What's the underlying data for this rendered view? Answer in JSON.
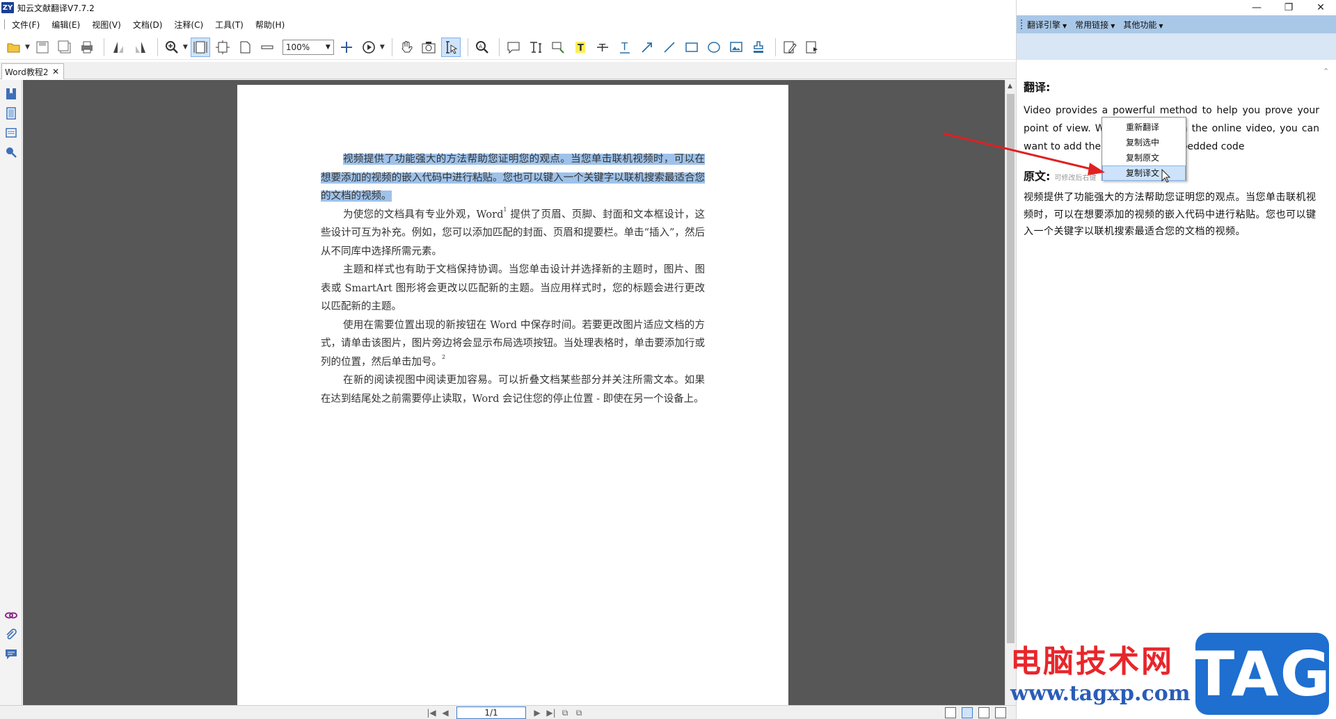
{
  "app": {
    "logo": "ZY",
    "title": "知云文献翻译V7.7.2"
  },
  "menu": [
    "文件(F)",
    "编辑(E)",
    "视图(V)",
    "文档(D)",
    "注释(C)",
    "工具(T)",
    "帮助(H)"
  ],
  "toolbar": {
    "zoom": "100%"
  },
  "tab": {
    "label": "Word教程2",
    "close": "✕"
  },
  "document": {
    "highlighted_paragraph": "视频提供了功能强大的方法帮助您证明您的观点。当您单击联机视频时，可以在想要添加的视频的嵌入代码中进行粘贴。您也可以键入一个关键字以联机搜索最适合您的文档的视频。",
    "p2_a": "为使您的文档具有专业外观，Word",
    "p2_sup": "1",
    "p2_b": " 提供了页眉、页脚、封面和文本框设计，这些设计可互为补充。例如，您可以添加匹配的封面、页眉和提要栏。单击“插入”，然后从不同库中选择所需元素。",
    "p3": "主题和样式也有助于文档保持协调。当您单击设计并选择新的主题时，图片、图表或 SmartArt 图形将会更改以匹配新的主题。当应用样式时，您的标题会进行更改以匹配新的主题。",
    "p4_a": "使用在需要位置出现的新按钮在 Word 中保存时间。若要更改图片适应文档的方式，请单击该图片，图片旁边将会显示布局选项按钮。当处理表格时，单击要添加行或列的位置，然后单击加号。",
    "p4_sup": "2",
    "p5": "在新的阅读视图中阅读更加容易。可以折叠文档某些部分并关注所需文本。如果在达到结尾处之前需要停止读取，Word 会记住您的停止位置 - 即使在另一个设备上。"
  },
  "status": {
    "page": "1/1"
  },
  "right_panel": {
    "toolbar": [
      "翻译引擎",
      "常用链接",
      "其他功能"
    ],
    "translation_heading": "翻译:",
    "translation_text": "Video provides a powerful method to help you prove your point of view. When you click on the online video, you can want to add the video to the embedded code",
    "original_heading": "原文:",
    "original_hint": "可修改后右键",
    "original_text": "视频提供了功能强大的方法帮助您证明您的观点。当您单击联机视频时，可以在想要添加的视频的嵌入代码中进行粘贴。您也可以键入一个关键字以联机搜索最适合您的文档的视频。"
  },
  "context_menu": [
    "重新翻译",
    "复制选中",
    "复制原文",
    "复制译文"
  ],
  "watermark": {
    "text": "电脑技术网",
    "url": "www.tagxp.com",
    "tag": "TAG"
  },
  "colors": {
    "highlight": "#9ec2ea",
    "panel_toolbar": "#a9c8e8",
    "doc_bg": "#575757",
    "arrow": "#e02020"
  }
}
